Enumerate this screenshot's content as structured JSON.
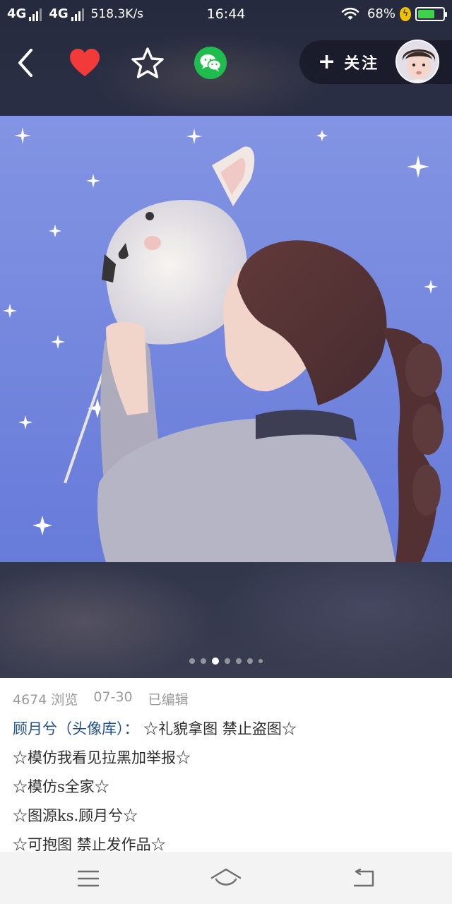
{
  "status_bar": {
    "network1": "4G",
    "network2": "4G",
    "speed": "518.3K/s",
    "time": "16:44",
    "battery_text": "68%",
    "battery_level": 0.68,
    "bolt": "ϟ"
  },
  "toolbar": {
    "back_icon": "chevron-left-icon",
    "like_icon": "heart-icon",
    "favorite_icon": "star-outline-icon",
    "share_icon": "wechat-icon",
    "follow_plus": "+",
    "follow_label": "关注"
  },
  "gallery": {
    "page_count": 7,
    "current_page": 3
  },
  "post": {
    "views": "4674 浏览",
    "date": "07-30",
    "edited": "已编辑",
    "author": "顾月兮（头像库）：",
    "lines": [
      " ☆礼貌拿图 禁止盗图☆",
      "☆模仿我看见拉黑加举报☆",
      "☆模仿s全家☆",
      "☆图源ks.顾月兮☆",
      "☆可抱图 禁止发作品☆"
    ]
  },
  "bottom_nav": {
    "menu_icon": "menu-icon",
    "home_icon": "home-icon",
    "back_icon": "return-icon"
  },
  "colors": {
    "accent_link": "#1f4f88",
    "like_red": "#f23a3a",
    "wechat_green": "#1fbd4e",
    "battery_green": "#3fd34b"
  }
}
